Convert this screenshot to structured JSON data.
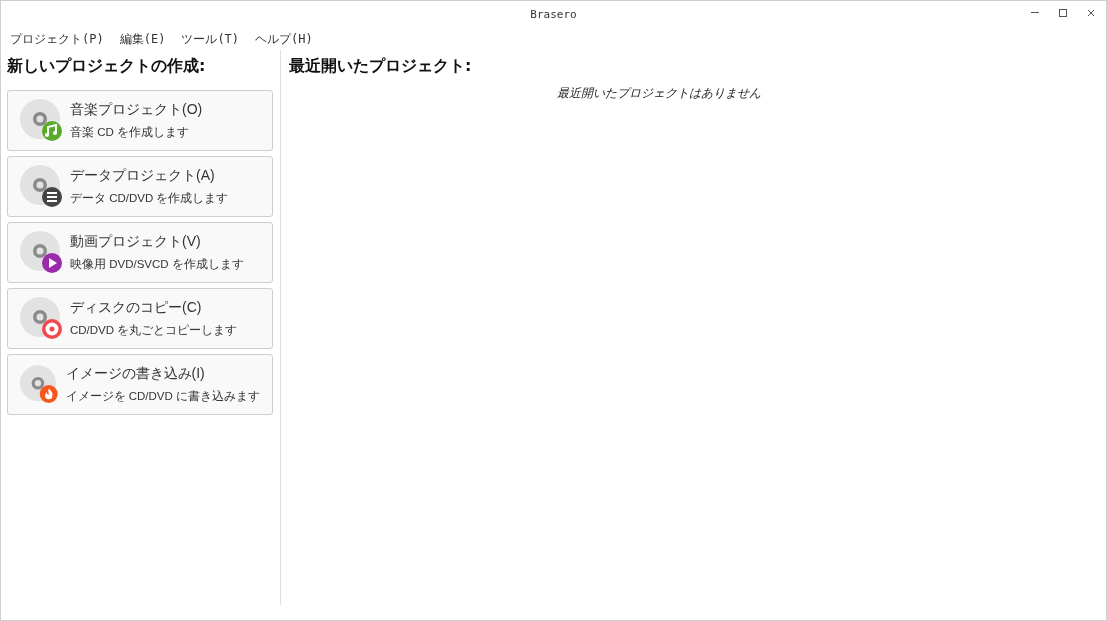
{
  "window": {
    "title": "Brasero"
  },
  "menu": [
    "プロジェクト(P)",
    "編集(E)",
    "ツール(T)",
    "ヘルプ(H)"
  ],
  "new_project": {
    "heading": "新しいプロジェクトの作成:",
    "items": [
      {
        "kind": "music",
        "title": "音楽プロジェクト(O)",
        "description": "音楽 CD を作成します"
      },
      {
        "kind": "data",
        "title": "データプロジェクト(A)",
        "description": "データ CD/DVD を作成します"
      },
      {
        "kind": "video",
        "title": "動画プロジェクト(V)",
        "description": "映像用 DVD/SVCD を作成します"
      },
      {
        "kind": "copy",
        "title": "ディスクのコピー(C)",
        "description": "CD/DVD を丸ごとコピーします"
      },
      {
        "kind": "burn",
        "title": "イメージの書き込み(I)",
        "description": "イメージを CD/DVD に書き込みます"
      }
    ]
  },
  "recent": {
    "heading": "最近開いたプロジェクト:",
    "empty_message": "最近開いたプロジェクトはありません"
  }
}
